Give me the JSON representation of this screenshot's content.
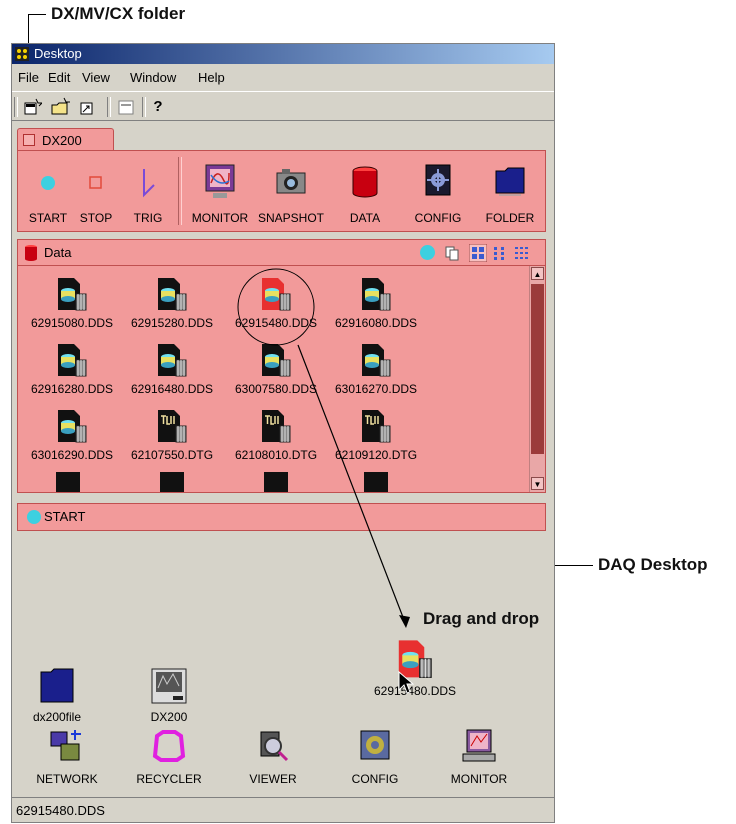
{
  "callouts": {
    "folder": "DX/MV/CX folder",
    "desktop": "DAQ Desktop",
    "drag": "Drag and drop"
  },
  "window": {
    "title": "Desktop",
    "menu": [
      "File",
      "Edit",
      "View",
      "Window",
      "Help"
    ],
    "tab": "DX200",
    "toolbar_help": "?"
  },
  "tools": [
    {
      "label": "START",
      "icon": "start-icon"
    },
    {
      "label": "STOP",
      "icon": "stop-icon"
    },
    {
      "label": "TRIG",
      "icon": "trigger-icon"
    },
    {
      "label": "MONITOR",
      "icon": "monitor-icon"
    },
    {
      "label": "SNAPSHOT",
      "icon": "camera-icon"
    },
    {
      "label": "DATA",
      "icon": "data-icon"
    },
    {
      "label": "CONFIG",
      "icon": "config-icon"
    },
    {
      "label": "FOLDER",
      "icon": "folder-icon"
    }
  ],
  "data_panel": {
    "title": "Data",
    "files": [
      [
        "62915080.DDS",
        "62915280.DDS",
        "62915480.DDS",
        "62916080.DDS"
      ],
      [
        "62916280.DDS",
        "62916480.DDS",
        "63007580.DDS",
        "63016270.DDS"
      ],
      [
        "63016290.DDS",
        "62107550.DTG",
        "62108010.DTG",
        "62109120.DTG"
      ]
    ],
    "status": "START"
  },
  "desktop_items": {
    "folder": "dx200file",
    "device": "DX200",
    "dragged": "62915480.DDS",
    "shortcuts": [
      "NETWORK",
      "RECYCLER",
      "VIEWER",
      "CONFIG",
      "MONITOR"
    ]
  },
  "status_text": "62915480.DDS",
  "colors": {
    "panel": "#f29a9a",
    "window": "#d6d3c9",
    "accent": "#3dd0e0"
  }
}
